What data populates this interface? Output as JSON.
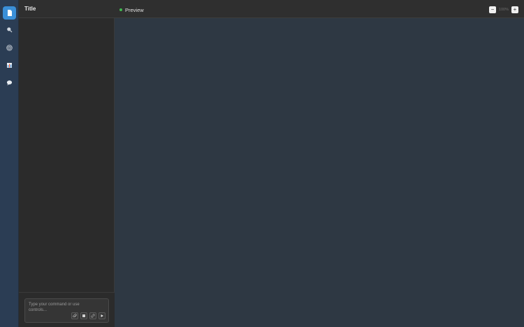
{
  "rail": {
    "items": [
      {
        "icon": "document-icon",
        "active": true
      },
      {
        "icon": "search-icon",
        "active": false
      },
      {
        "icon": "target-icon",
        "active": false
      },
      {
        "icon": "chart-icon",
        "active": false
      },
      {
        "icon": "chat-bubble-icon",
        "active": false
      }
    ]
  },
  "panel": {
    "title": "Title"
  },
  "composer": {
    "placeholder": "Type your command or use controls...",
    "tools": [
      "attach-icon",
      "stop-icon",
      "link-icon",
      "send-icon"
    ]
  },
  "preview": {
    "title": "Preview",
    "status_color": "#3fb950",
    "zoom_out": "−",
    "zoom_level": "100%",
    "zoom_in": "+"
  },
  "colors": {
    "accent": "#3a8fd8",
    "rail_bg": "#2b3d54",
    "panel_bg": "#2b2b2b",
    "preview_bg": "#2e3843"
  }
}
